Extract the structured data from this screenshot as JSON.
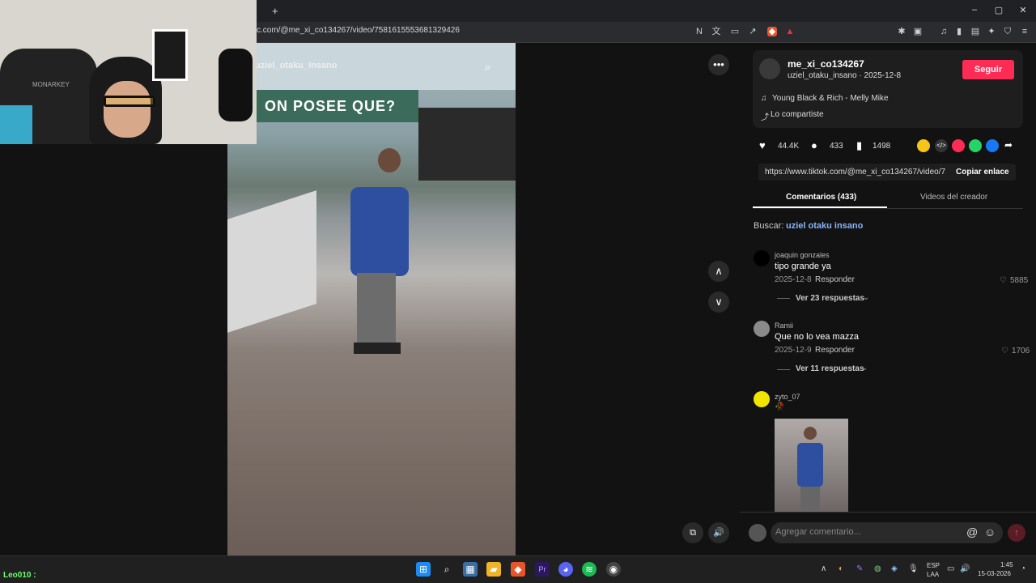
{
  "browser": {
    "new_tab_label": "+",
    "url": "c.com/@me_xi_co134267/video/7581615553681329426",
    "window_controls": {
      "minimize": "–",
      "maximize": "▢",
      "close": "✕"
    }
  },
  "video": {
    "overlay_handle": "uziel_otaku_insano",
    "more_icon": "•••",
    "up_icon": "∧",
    "down_icon": "∨",
    "billboard_text": "ON POSEE QUE?"
  },
  "post": {
    "username": "me_xi_co134267",
    "subline": "uziel_otaku_insano · 2025-12-8",
    "follow_label": "Seguir",
    "music": "Young Black & Rich - Melly Mike",
    "shared_label": "Lo compartiste",
    "likes": "44.4K",
    "comments": "433",
    "saves": "1498",
    "link": "https://www.tiktok.com/@me_xi_co134267/video/7...",
    "copy_link_label": "Copiar enlace"
  },
  "tabs": {
    "comments": "Comentarios (433)",
    "creator_videos": "Videos del creador"
  },
  "search": {
    "label": "Buscar:",
    "query": "uziel otaku insano"
  },
  "comments": [
    {
      "name": "joaquin gonzales",
      "text": "tipo grande ya",
      "date": "2025-12-8",
      "reply": "Responder",
      "likes": "5885",
      "replies": "Ver 23 respuestas",
      "avatar_color": "#000000"
    },
    {
      "name": "Ramii",
      "text": "Que no lo vea mazza",
      "date": "2025-12-9",
      "reply": "Responder",
      "likes": "1706",
      "replies": "Ver 11 respuestas",
      "avatar_color": "#8a8a8a"
    },
    {
      "name": "zyto_07",
      "text": "🥀",
      "avatar_color": "#f2e600"
    }
  ],
  "composer": {
    "placeholder": "Agregar comentario..."
  },
  "taskbar": {
    "user_label": "Leo010 :",
    "lang": "ESP",
    "lang2": "LAA",
    "time": "1:45",
    "date": "15-03-2026"
  },
  "colors": {
    "accent": "#fe2c55",
    "link_blue": "#8ab4f8"
  }
}
